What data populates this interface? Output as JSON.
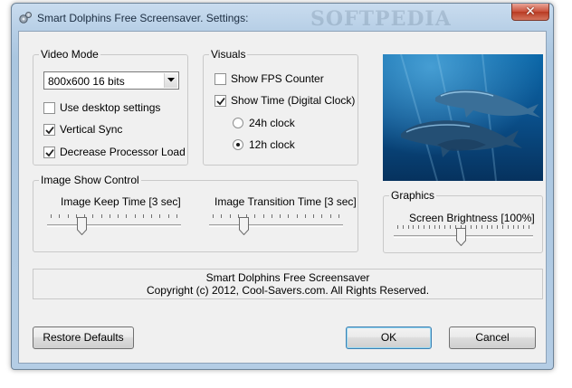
{
  "window": {
    "title": "Smart Dolphins Free Screensaver. Settings:",
    "watermark": "SOFTPEDIA",
    "close_glyph": "✕"
  },
  "video_mode": {
    "legend": "Video Mode",
    "resolution": {
      "selected": "800x600 16 bits"
    },
    "use_desktop_settings": {
      "label": "Use desktop settings",
      "checked": false
    },
    "vertical_sync": {
      "label": "Vertical Sync",
      "checked": true
    },
    "decrease_processor_load": {
      "label": "Decrease Processor Load",
      "checked": true
    }
  },
  "visuals": {
    "legend": "Visuals",
    "show_fps_counter": {
      "label": "Show FPS Counter",
      "checked": false
    },
    "show_time": {
      "label": "Show Time (Digital Clock)",
      "checked": true
    },
    "clock_24h": {
      "label": "24h clock",
      "selected": false
    },
    "clock_12h": {
      "label": "12h clock",
      "selected": true
    }
  },
  "image_show_control": {
    "legend": "Image Show Control",
    "keep_time": {
      "caption": "Image Keep Time [3 sec]",
      "value_fraction": 0.24
    },
    "transition_time": {
      "caption": "Image Transition Time [3 sec]",
      "value_fraction": 0.24
    }
  },
  "graphics": {
    "legend": "Graphics",
    "brightness": {
      "caption": "Screen Brightness [100%]",
      "value_fraction": 0.48
    }
  },
  "info": {
    "line1": "Smart Dolphins Free Screensaver",
    "line2": "Copyright (c) 2012, Cool-Savers.com. All Rights Reserved."
  },
  "buttons": {
    "restore_defaults": "Restore Defaults",
    "ok": "OK",
    "cancel": "Cancel"
  },
  "icons": {
    "app": "gears-icon",
    "close": "close-icon",
    "dropdown": "chevron-down-icon",
    "check": "checkmark-icon"
  },
  "colors": {
    "title_bar": "#c9dcef",
    "close_button": "#c9503a",
    "dialog_face": "#f0f0f0",
    "default_button_border": "#3c7fb1"
  }
}
